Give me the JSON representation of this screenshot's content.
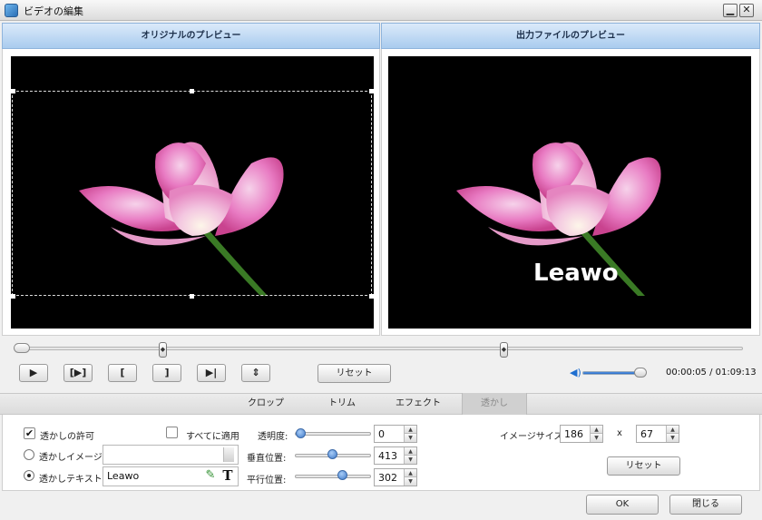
{
  "window": {
    "title": "ビデオの編集",
    "min_glyph": "▁",
    "close_glyph": "✕"
  },
  "preview": {
    "original_label": "オリジナルのプレビュー",
    "output_label": "出力ファイルのプレビュー"
  },
  "controls": {
    "play": "▶",
    "play_selection": "[▶]",
    "mark_in": "[",
    "mark_out": "]",
    "prev": "▶|",
    "split": "⇕",
    "reset_label": "リセット",
    "timecode": "00:00:05 / 01:09:13",
    "volume_icon": "speaker-icon"
  },
  "tabs": [
    {
      "label": "クロップ"
    },
    {
      "label": "トリム"
    },
    {
      "label": "エフェクト"
    },
    {
      "label": "透かし",
      "active": true
    }
  ],
  "watermark": {
    "enable_label": "透かしの許可",
    "enable_checked": true,
    "apply_all_label": "すべてに適用",
    "apply_all_checked": false,
    "image_label": "透かしイメージ:",
    "image_path": "",
    "text_label": "透かしテキスト:",
    "text_value": "Leawo",
    "opacity_label": "透明度:",
    "opacity_value": "0",
    "vpos_label": "垂直位置:",
    "vpos_value": "413",
    "hpos_label": "平行位置:",
    "hpos_value": "302",
    "image_size_label": "イメージサイズ:",
    "width_value": "186",
    "x_label": "x",
    "height_value": "67",
    "reset_label": "リセット",
    "preview_text": "Leawo"
  },
  "dialog": {
    "ok_label": "OK",
    "close_label": "閉じる"
  }
}
